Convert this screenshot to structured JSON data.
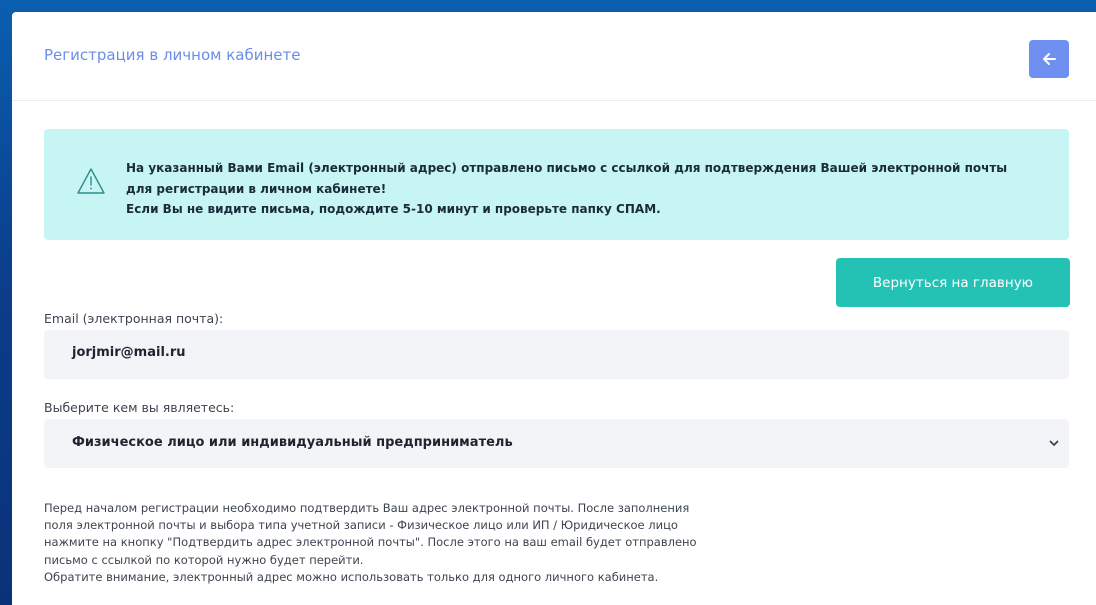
{
  "header": {
    "title": "Регистрация в личном кабинете",
    "back_icon": "arrow-left-icon",
    "accent_color": "#6f90f0"
  },
  "alert": {
    "icon": "warning-triangle-icon",
    "lines": [
      "На указанный Вами Email (электронный адрес) отправлено письмо с ссылкой для подтверждения Вашей электронной почты",
      "для регистрации в личном кабинете!",
      "Если Вы не видите письма, подождите 5-10 минут и проверьте папку СПАМ."
    ],
    "background": "#c6f5f3"
  },
  "home_button": {
    "label": "Вернуться на главную",
    "color": "#23c2b4"
  },
  "email": {
    "label": "Email (электронная почта):",
    "value": "jorjmir@mail.ru"
  },
  "account_type": {
    "label": "Выберите кем вы являетесь:",
    "selected": "Физическое лицо или индивидуальный предприниматель",
    "icon": "chevron-down-icon"
  },
  "info": {
    "lines": [
      "Перед началом регистрации необходимо подтвердить Ваш адрес электронной почты. После заполнения",
      "поля электронной почты и выбора типа учетной записи - Физическое лицо или ИП / Юридическое лицо",
      "нажмите на кнопку \"Подтвердить адрес электронной почты\". После этого на ваш email будет отправлено",
      "письмо с ссылкой по которой нужно будет перейти.",
      "Обратите внимание, электронный адрес можно использовать только для одного личного кабинета."
    ]
  }
}
